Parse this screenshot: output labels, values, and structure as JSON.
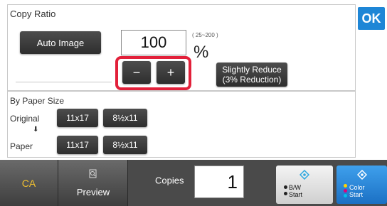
{
  "header": {
    "title": "Copy Ratio",
    "ok_label": "OK"
  },
  "ratio": {
    "auto_image_label": "Auto Image",
    "value": "100",
    "range": "( 25~200 )",
    "unit": "%",
    "minus_label": "−",
    "plus_label": "+",
    "slightly_reduce_line1": "Slightly Reduce",
    "slightly_reduce_line2": "(3% Reduction)"
  },
  "paper_size": {
    "section_label": "By Paper Size",
    "original_label": "Original",
    "paper_label": "Paper",
    "original_options": [
      "11x17",
      "8½x11"
    ],
    "paper_options": [
      "11x17",
      "8½x11"
    ]
  },
  "bottom_bar": {
    "ca_label": "CA",
    "preview_label": "Preview",
    "copies_label": "Copies",
    "copies_value": "1",
    "bw_line1": "B/W",
    "bw_line2": "Start",
    "color_line1": "Color",
    "color_line2": "Start"
  },
  "colors": {
    "accent": "#1e86d6",
    "highlight": "#e2203a",
    "ca": "#f0c030"
  },
  "icons": {
    "ok": "ok-icon",
    "preview": "magnifier-page-icon",
    "start": "diamond-start-icon",
    "arrow": "down-arrow-icon"
  }
}
